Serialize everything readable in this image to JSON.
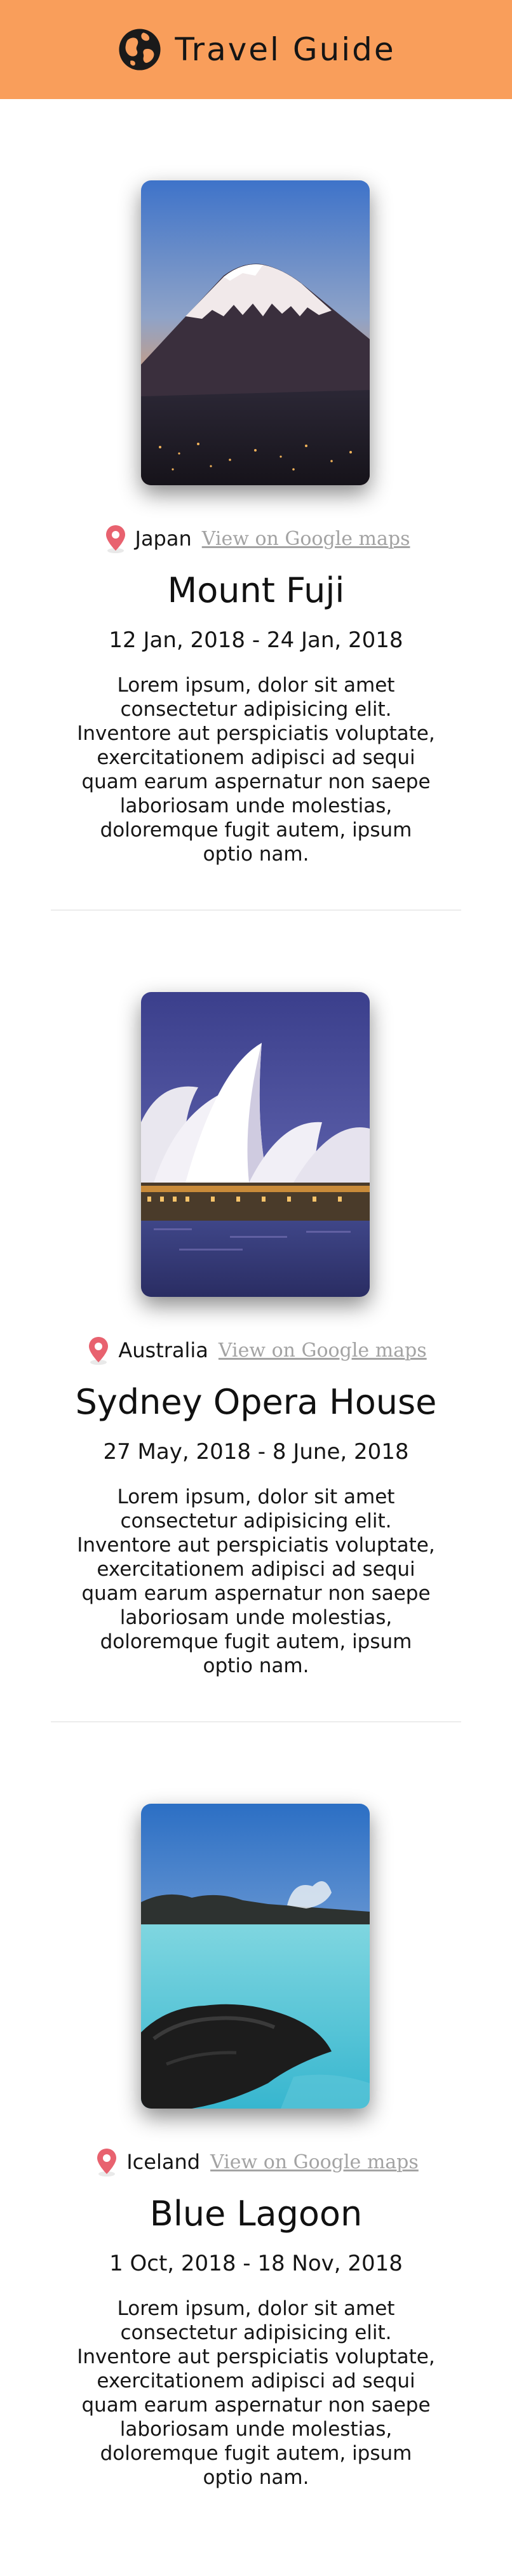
{
  "header": {
    "title": "Travel Guide",
    "icon": "globe-icon",
    "background": "#f99e5b"
  },
  "entries": [
    {
      "country": "Japan",
      "maps_link": "View on Google maps",
      "title": "Mount Fuji",
      "dates": "12 Jan, 2018 - 24 Jan, 2018",
      "description": "Lorem ipsum, dolor sit amet consectetur adipisicing elit. Inventore aut perspiciatis voluptate, exercitationem adipisci ad sequi quam earum aspernatur non saepe laboriosam unde molestias, doloremque fugit autem, ipsum optio nam."
    },
    {
      "country": "Australia",
      "maps_link": "View on Google maps",
      "title": "Sydney Opera House",
      "dates": "27 May, 2018 - 8 June, 2018",
      "description": "Lorem ipsum, dolor sit amet consectetur adipisicing elit. Inventore aut perspiciatis voluptate, exercitationem adipisci ad sequi quam earum aspernatur non saepe laboriosam unde molestias, doloremque fugit autem, ipsum optio nam."
    },
    {
      "country": "Iceland",
      "maps_link": "View on Google maps",
      "title": "Blue Lagoon",
      "dates": "1 Oct, 2018 - 18 Nov, 2018",
      "description": "Lorem ipsum, dolor sit amet consectetur adipisicing elit. Inventore aut perspiciatis voluptate, exercitationem adipisci ad sequi quam earum aspernatur non saepe laboriosam unde molestias, doloremque fugit autem, ipsum optio nam."
    }
  ],
  "icons": {
    "pin": "map-pin-icon",
    "pin_color": "#e8626f"
  }
}
